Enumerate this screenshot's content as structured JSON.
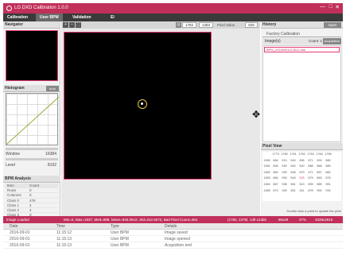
{
  "app": {
    "title": "LG DXD Calibration 1.0.0"
  },
  "window_controls": {
    "minimize": "—",
    "maximize": "□",
    "close": "✕"
  },
  "tabs": [
    {
      "label": "Calibration"
    },
    {
      "label": "User BPM"
    },
    {
      "label": "Validation"
    },
    {
      "label": "EI"
    }
  ],
  "navigator": {
    "title": "Navigator"
  },
  "histogram": {
    "title": "Histogram",
    "auto_label": "Auto",
    "window_label": "Window",
    "window_value": "16384",
    "level_label": "Level",
    "level_value": "8192"
  },
  "bpm_analysis": {
    "title": "BPM Analysis",
    "columns": [
      "Item",
      "Count"
    ],
    "rows": [
      [
        "Rows",
        "0"
      ],
      [
        "Columns",
        "0"
      ],
      [
        "Class 0",
        "476"
      ],
      [
        "Class 1",
        "4"
      ],
      [
        "Class 2",
        "4"
      ],
      [
        "Class 3",
        "0"
      ],
      [
        "Class 4",
        "0"
      ],
      [
        "Class 5~8",
        "0"
      ]
    ]
  },
  "center_toolbar": {
    "x_value": "1782",
    "y_value": "1383",
    "pixel_label": "Pixel Value",
    "pixel_value": "525"
  },
  "history": {
    "title": "History",
    "open_label": "Open",
    "factory_tab": "Factory Calibration",
    "images_label": "Image(s)",
    "count_label": "Count: 1",
    "acquisition_label": "Acquisition",
    "items": [
      "BPM_20160901113512.raw"
    ]
  },
  "pixel_view": {
    "title": "Pixel View",
    "header": [
      "",
      "1779",
      "1780",
      "1781",
      "1782",
      "1783",
      "1784",
      "1785"
    ],
    "rows": [
      [
        "1380",
        "884",
        "913",
        "549",
        "896",
        "871",
        "900",
        "880"
      ],
      [
        "1381",
        "895",
        "930",
        "540",
        "520",
        "888",
        "868",
        "889"
      ],
      [
        "1382",
        "883",
        "939",
        "548",
        "879",
        "471",
        "867",
        "862"
      ],
      [
        "1383",
        "884",
        "930",
        "518",
        "525",
        "879",
        "863",
        "876"
      ],
      [
        "1384",
        "887",
        "938",
        "561",
        "513",
        "899",
        "889",
        "951"
      ],
      [
        "1385",
        "873",
        "925",
        "551",
        "511",
        "878",
        "900",
        "933"
      ]
    ],
    "note": "Double click a point to update the pixel"
  },
  "status": {
    "left": "Image Loaded",
    "stats": "Min=0, Max=1837, Med=888, Mean=845.0542, Std=242.6572, Bad Pixel Count=484",
    "coords": "(1782, 1378)",
    "size": "14fr.x13bit",
    "scale": "86x28",
    "zoom": "27%",
    "dims": "3328x2816"
  },
  "log": {
    "columns": [
      "Date",
      "Time",
      "Type",
      "Details"
    ],
    "rows": [
      [
        "2016-09-01",
        "11:15:12",
        "User BPM",
        "Image saved"
      ],
      [
        "2016-09-01",
        "11:15:13",
        "User BPM",
        "Image opened"
      ],
      [
        "2016-09-01",
        "11:15:13",
        "User BPM",
        "Acquisition end"
      ]
    ]
  }
}
